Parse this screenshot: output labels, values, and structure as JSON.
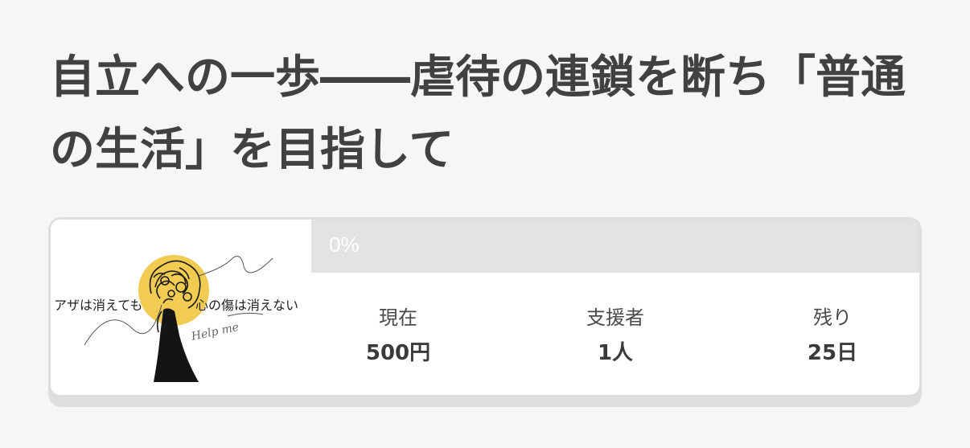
{
  "project": {
    "title": "自立への一歩――虐待の連鎖を断ち「普通の生活」を目指して",
    "thumbnail": {
      "text_left": "アザは消えても",
      "text_right": "心の傷は消えない",
      "text_script": "Help me",
      "accent_color": "#f2cc52"
    },
    "progress": {
      "percent": 0,
      "label": "0%",
      "track_color": "#e3e3e3",
      "label_color": "#ffffff"
    },
    "stats": [
      {
        "label": "現在",
        "value": "500円"
      },
      {
        "label": "支援者",
        "value": "1人"
      },
      {
        "label": "残り",
        "value": "25日"
      }
    ]
  }
}
